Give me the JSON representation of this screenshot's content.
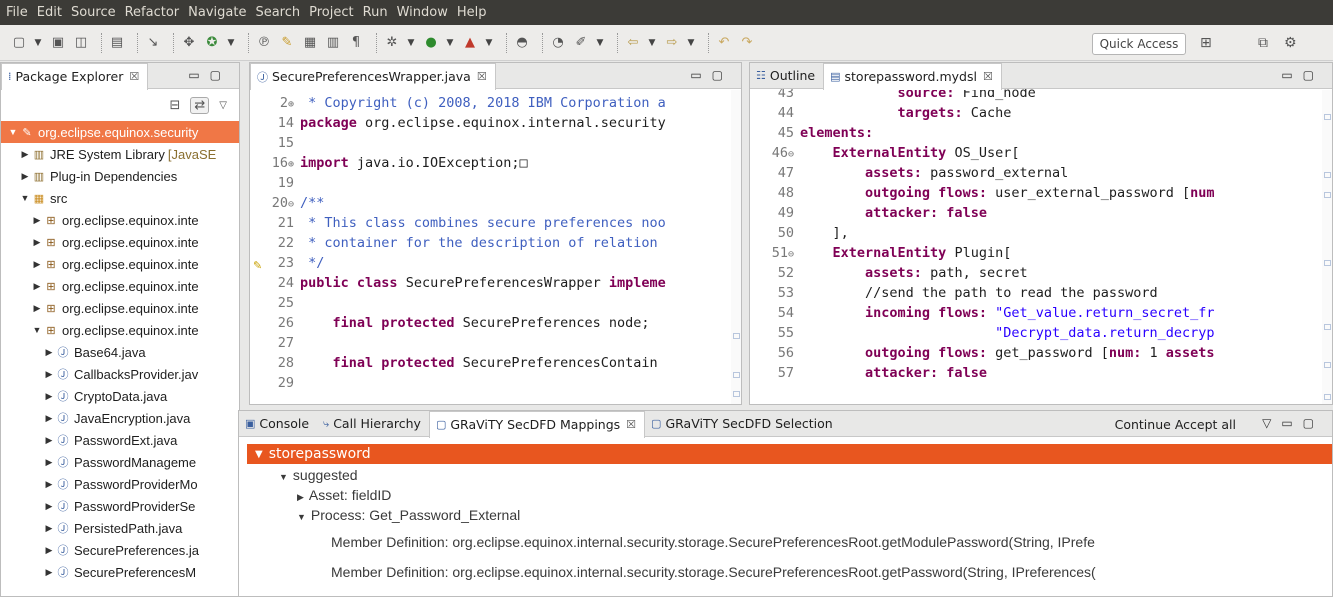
{
  "menu": [
    "File",
    "Edit",
    "Source",
    "Refactor",
    "Navigate",
    "Search",
    "Project",
    "Run",
    "Window",
    "Help"
  ],
  "toolbar": {
    "quick_access": "Quick Access"
  },
  "package_explorer": {
    "tab_label": "Package Explorer",
    "tree": [
      {
        "label": "org.eclipse.equinox.security",
        "level": 0,
        "expanded": true,
        "selected": true,
        "icon": "project-icon"
      },
      {
        "label": "JRE System Library",
        "suffix": "[JavaSE",
        "level": 1,
        "expanded": false,
        "icon": "library-icon"
      },
      {
        "label": "Plug-in Dependencies",
        "level": 1,
        "expanded": false,
        "icon": "library-icon"
      },
      {
        "label": "src",
        "level": 1,
        "expanded": true,
        "icon": "source-folder-icon"
      },
      {
        "label": "org.eclipse.equinox.inte",
        "level": 2,
        "expanded": false,
        "icon": "package-icon"
      },
      {
        "label": "org.eclipse.equinox.inte",
        "level": 2,
        "expanded": false,
        "icon": "package-icon"
      },
      {
        "label": "org.eclipse.equinox.inte",
        "level": 2,
        "expanded": false,
        "icon": "package-icon"
      },
      {
        "label": "org.eclipse.equinox.inte",
        "level": 2,
        "expanded": false,
        "icon": "package-icon"
      },
      {
        "label": "org.eclipse.equinox.inte",
        "level": 2,
        "expanded": false,
        "icon": "package-icon"
      },
      {
        "label": "org.eclipse.equinox.inte",
        "level": 2,
        "expanded": true,
        "icon": "package-icon"
      },
      {
        "label": "Base64.java",
        "level": 3,
        "expanded": false,
        "icon": "java-file-icon"
      },
      {
        "label": "CallbacksProvider.jav",
        "level": 3,
        "expanded": false,
        "icon": "java-file-icon"
      },
      {
        "label": "CryptoData.java",
        "level": 3,
        "expanded": false,
        "icon": "java-file-icon"
      },
      {
        "label": "JavaEncryption.java",
        "level": 3,
        "expanded": false,
        "icon": "java-file-icon"
      },
      {
        "label": "PasswordExt.java",
        "level": 3,
        "expanded": false,
        "icon": "java-file-icon"
      },
      {
        "label": "PasswordManageme",
        "level": 3,
        "expanded": false,
        "icon": "java-file-icon"
      },
      {
        "label": "PasswordProviderMo",
        "level": 3,
        "expanded": false,
        "icon": "java-file-icon"
      },
      {
        "label": "PasswordProviderSe",
        "level": 3,
        "expanded": false,
        "icon": "java-file-icon"
      },
      {
        "label": "PersistedPath.java",
        "level": 3,
        "expanded": false,
        "icon": "java-file-icon"
      },
      {
        "label": "SecurePreferences.ja",
        "level": 3,
        "expanded": false,
        "icon": "java-file-icon"
      },
      {
        "label": "SecurePreferencesM",
        "level": 3,
        "expanded": false,
        "icon": "java-file-icon"
      }
    ]
  },
  "java_editor": {
    "tab_label": "SecurePreferencesWrapper.java",
    "lines": [
      {
        "num": "2",
        "fold": "⊕",
        "parts": [
          {
            "t": " * Copyright (c) 2008, 2018 IBM Corporation a",
            "c": "cm"
          }
        ]
      },
      {
        "num": "14",
        "fold": "",
        "parts": [
          {
            "t": "package",
            "c": "kw"
          },
          {
            "t": " org.eclipse.equinox.internal.security",
            "c": ""
          }
        ]
      },
      {
        "num": "15",
        "fold": "",
        "parts": []
      },
      {
        "num": "16",
        "fold": "⊕",
        "parts": [
          {
            "t": "import",
            "c": "kw"
          },
          {
            "t": " java.io.IOException;",
            "c": ""
          },
          {
            "t": "□",
            "c": ""
          }
        ]
      },
      {
        "num": "19",
        "fold": "",
        "parts": []
      },
      {
        "num": "20",
        "fold": "⊖",
        "parts": [
          {
            "t": "/**",
            "c": "cm"
          }
        ]
      },
      {
        "num": "21",
        "fold": "",
        "parts": [
          {
            "t": " * This class combines secure preferences noo",
            "c": "cm"
          }
        ]
      },
      {
        "num": "22",
        "fold": "",
        "parts": [
          {
            "t": " * container for the description of relation",
            "c": "cm"
          }
        ]
      },
      {
        "num": "23",
        "fold": "",
        "parts": [
          {
            "t": " */",
            "c": "cm"
          }
        ]
      },
      {
        "num": "24",
        "fold": "",
        "parts": [
          {
            "t": "public",
            "c": "kw"
          },
          {
            "t": " ",
            "c": ""
          },
          {
            "t": "class",
            "c": "kw"
          },
          {
            "t": " SecurePreferencesWrapper ",
            "c": ""
          },
          {
            "t": "impleme",
            "c": "kw"
          }
        ]
      },
      {
        "num": "25",
        "fold": "",
        "parts": []
      },
      {
        "num": "26",
        "fold": "",
        "parts": [
          {
            "t": "    ",
            "c": ""
          },
          {
            "t": "final",
            "c": "kw"
          },
          {
            "t": " ",
            "c": ""
          },
          {
            "t": "protected",
            "c": "kw"
          },
          {
            "t": " SecurePreferences node;",
            "c": ""
          }
        ]
      },
      {
        "num": "27",
        "fold": "",
        "parts": []
      },
      {
        "num": "28",
        "fold": "",
        "parts": [
          {
            "t": "    ",
            "c": ""
          },
          {
            "t": "final",
            "c": "kw"
          },
          {
            "t": " ",
            "c": ""
          },
          {
            "t": "protected",
            "c": "kw"
          },
          {
            "t": " SecurePreferencesContain",
            "c": ""
          }
        ]
      },
      {
        "num": "29",
        "fold": "",
        "parts": []
      }
    ]
  },
  "dsl_editor": {
    "outline_tab": "Outline",
    "tab_label": "storepassword.mydsl",
    "lines": [
      {
        "num": "43",
        "fold": "",
        "parts": [
          {
            "t": "            ",
            "c": ""
          },
          {
            "t": "source:",
            "c": "kw"
          },
          {
            "t": " Find_node",
            "c": ""
          }
        ]
      },
      {
        "num": "44",
        "fold": "",
        "parts": [
          {
            "t": "            ",
            "c": ""
          },
          {
            "t": "targets:",
            "c": "kw"
          },
          {
            "t": " Cache",
            "c": ""
          }
        ]
      },
      {
        "num": "45",
        "fold": "",
        "parts": [
          {
            "t": "elements:",
            "c": "kw"
          }
        ]
      },
      {
        "num": "46",
        "fold": "⊖",
        "parts": [
          {
            "t": "    ",
            "c": ""
          },
          {
            "t": "ExternalEntity",
            "c": "kw"
          },
          {
            "t": " OS_User[",
            "c": ""
          }
        ]
      },
      {
        "num": "47",
        "fold": "",
        "parts": [
          {
            "t": "        ",
            "c": ""
          },
          {
            "t": "assets:",
            "c": "kw"
          },
          {
            "t": " password_external",
            "c": ""
          }
        ]
      },
      {
        "num": "48",
        "fold": "",
        "parts": [
          {
            "t": "        ",
            "c": ""
          },
          {
            "t": "outgoing flows:",
            "c": "kw"
          },
          {
            "t": " user_external_password [",
            "c": ""
          },
          {
            "t": "num",
            "c": "kw"
          }
        ]
      },
      {
        "num": "49",
        "fold": "",
        "parts": [
          {
            "t": "        ",
            "c": ""
          },
          {
            "t": "attacker: false",
            "c": "kw"
          }
        ]
      },
      {
        "num": "50",
        "fold": "",
        "parts": [
          {
            "t": "    ],",
            "c": ""
          }
        ]
      },
      {
        "num": "51",
        "fold": "⊖",
        "parts": [
          {
            "t": "    ",
            "c": ""
          },
          {
            "t": "ExternalEntity",
            "c": "kw"
          },
          {
            "t": " Plugin[",
            "c": ""
          }
        ]
      },
      {
        "num": "52",
        "fold": "",
        "parts": [
          {
            "t": "        ",
            "c": ""
          },
          {
            "t": "assets:",
            "c": "kw"
          },
          {
            "t": " path, secret",
            "c": ""
          }
        ]
      },
      {
        "num": "53",
        "fold": "",
        "parts": [
          {
            "t": "        //send the path to read the password",
            "c": ""
          }
        ]
      },
      {
        "num": "54",
        "fold": "",
        "parts": [
          {
            "t": "        ",
            "c": ""
          },
          {
            "t": "incoming flows:",
            "c": "kw"
          },
          {
            "t": " ",
            "c": ""
          },
          {
            "t": "\"Get_value.return_secret_fr",
            "c": "str"
          }
        ]
      },
      {
        "num": "55",
        "fold": "",
        "parts": [
          {
            "t": "                        ",
            "c": ""
          },
          {
            "t": "\"Decrypt_data.return_decryp",
            "c": "str"
          }
        ]
      },
      {
        "num": "56",
        "fold": "",
        "parts": [
          {
            "t": "        ",
            "c": ""
          },
          {
            "t": "outgoing flows:",
            "c": "kw"
          },
          {
            "t": " get_password [",
            "c": ""
          },
          {
            "t": "num:",
            "c": "kw"
          },
          {
            "t": " 1 ",
            "c": ""
          },
          {
            "t": "assets",
            "c": "kw"
          }
        ]
      },
      {
        "num": "57",
        "fold": "",
        "parts": [
          {
            "t": "        ",
            "c": ""
          },
          {
            "t": "attacker: false",
            "c": "kw"
          }
        ]
      }
    ]
  },
  "bottom": {
    "tabs": [
      "Console",
      "Call Hierarchy",
      "GRaViTY SecDFD Mappings",
      "GRaViTY SecDFD Selection"
    ],
    "actions": [
      "Continue",
      "Accept all"
    ],
    "root": "storepassword",
    "suggested": "suggested",
    "asset": "Asset: fieldID",
    "process": "Process: Get_Password_External",
    "members": [
      "Member Definition: org.eclipse.equinox.internal.security.storage.SecurePreferencesRoot.getModulePassword(String, IPrefe",
      "Member Definition: org.eclipse.equinox.internal.security.storage.SecurePreferencesRoot.getPassword(String, IPreferences("
    ]
  }
}
